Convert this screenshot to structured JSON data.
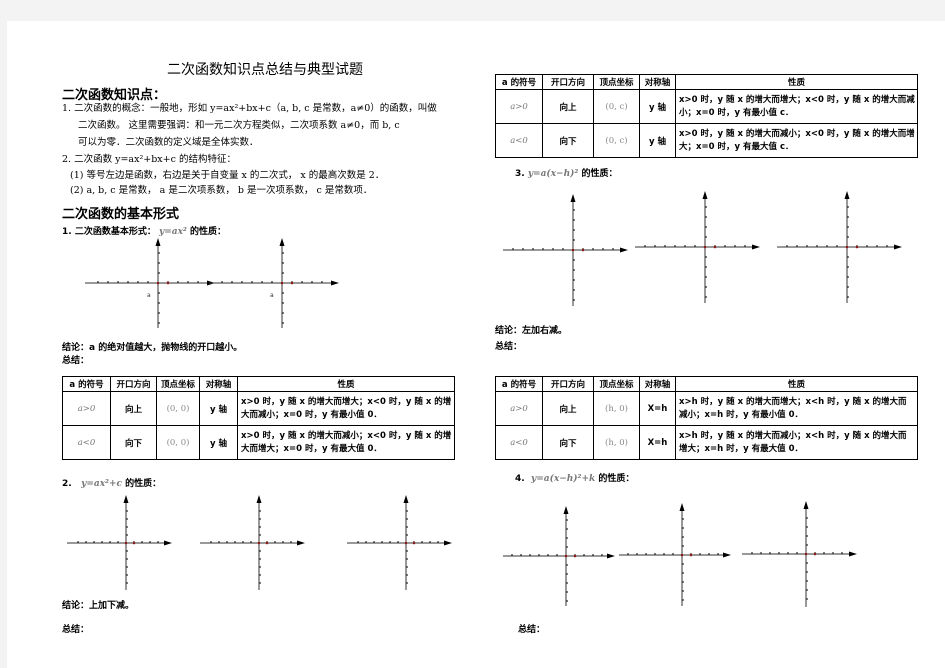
{
  "document": {
    "title": "二次函数知识点总结与典型试题",
    "section1": {
      "heading": "二次函数知识点：",
      "item1_line1": "1.  二次函数的概念：一般地，形如 y=ax²+bx+c（a, b, c 是常数，a≠0）的函数，叫做",
      "item1_line2": "二次函数。            这里需要强调：和一元二次方程类似，二次项系数 a≠0，而 b, c",
      "item1_line3": "可以为零．二次函数的定义域是全体实数．",
      "item2_line1": "2.  二次函数 y=ax²+bx+c 的结构特征：",
      "item2_sub1": "(1)  等号左边是函数，右边是关于自变量 x 的二次式， x 的最高次数是 2．",
      "item2_sub2": "(2)  a, b, c 是常数， a 是二次项系数， b 是一次项系数， c 是常数项．"
    },
    "section2": {
      "heading": "二次函数的基本形式",
      "form1": {
        "label": "1.  二次函数基本形式：",
        "formula": "y=ax²",
        "suffix": "的性质：",
        "point_label": "a",
        "conclusion": "结论：a 的绝对值越大，抛物线的开口越小。",
        "summary": "总结：",
        "table": {
          "headers": [
            "a 的符号",
            "开口方向",
            "顶点坐标",
            "对称轴",
            "性质"
          ],
          "rows": [
            {
              "sign": "a>0",
              "direction": "向上",
              "vertex": "(0, 0)",
              "axis": "y 轴",
              "property": "x>0 时，y 随 x 的增大而增大；x<0 时，y 随 x 的增大而减小；x=0 时，y 有最小值 0．"
            },
            {
              "sign": "a<0",
              "direction": "向下",
              "vertex": "(0, 0)",
              "axis": "y 轴",
              "property": "x>0 时，y 随 x 的增大而减小；x<0 时，y 随 x 的增大而增大；x=0 时，y 有最大值 0．"
            }
          ]
        }
      },
      "form2": {
        "label": "2.",
        "formula": "y=ax²+c",
        "suffix": "的性质：",
        "conclusion": "结论：上加下减。",
        "summary": "总结：",
        "table": {
          "headers": [
            "a 的符号",
            "开口方向",
            "顶点坐标",
            "对称轴",
            "性质"
          ],
          "rows": [
            {
              "sign": "a>0",
              "direction": "向上",
              "vertex": "(0, c)",
              "axis": "y 轴",
              "property": "x>0 时，y 随 x 的增大而增大；x<0 时，y 随 x 的增大而减小；x=0 时，y 有最小值 c．"
            },
            {
              "sign": "a<0",
              "direction": "向下",
              "vertex": "(0, c)",
              "axis": "y 轴",
              "property": "x>0 时，y 随 x 的增大而减小；x<0 时，y 随 x 的增大而增大；x=0 时，y 有最大值 c．"
            }
          ]
        }
      },
      "form3": {
        "label": "3.",
        "formula": "y=a(x−h)²",
        "suffix": "的性质：",
        "conclusion": "结论：左加右减。",
        "summary": "总结：",
        "table": {
          "headers": [
            "a 的符号",
            "开口方向",
            "顶点坐标",
            "对称轴",
            "性质"
          ],
          "rows": [
            {
              "sign": "a>0",
              "direction": "向上",
              "vertex": "(h, 0)",
              "axis": "X=h",
              "property": "x>h 时，y 随 x 的增大而增大；x<h 时，y 随 x 的增大而减小；x=h 时，y 有最小值 0．"
            },
            {
              "sign": "a<0",
              "direction": "向下",
              "vertex": "(h, 0)",
              "axis": "X=h",
              "property": "x>h 时，y 随 x 的增大而减小；x<h 时，y 随 x 的增大而增大；x=h 时，y 有最大值 0．"
            }
          ]
        }
      },
      "form4": {
        "label": "4.",
        "formula": "y=a(x−h)²+k",
        "suffix": "的性质：",
        "summary": "总结："
      }
    }
  }
}
